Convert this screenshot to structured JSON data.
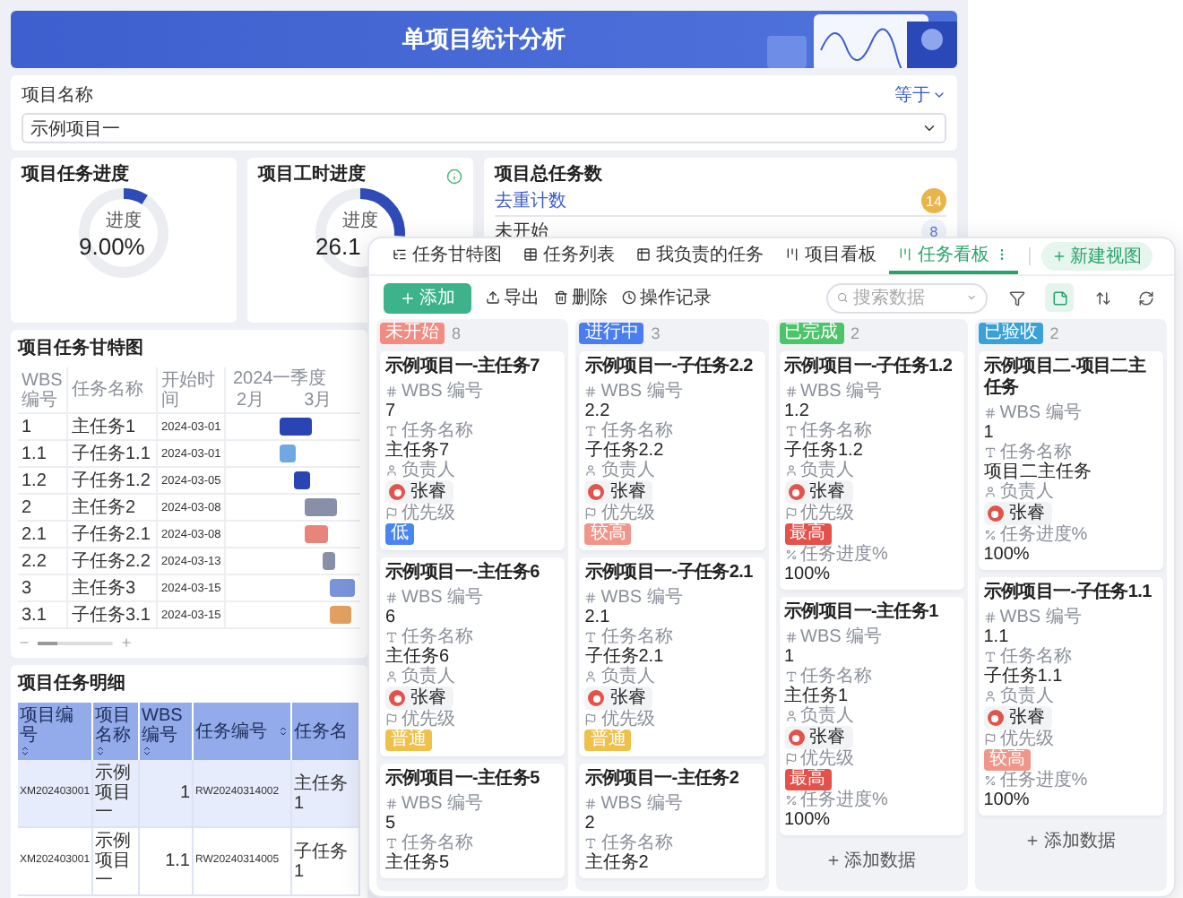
{
  "banner": {
    "title": "单项目统计分析"
  },
  "filter": {
    "label": "项目名称",
    "operator": "等于",
    "value": "示例项目一"
  },
  "progress_cards": [
    {
      "title": "项目任务进度",
      "caption": "进度",
      "value": "9.00%",
      "level": 0.09,
      "info": false
    },
    {
      "title": "项目工时进度",
      "caption": "进度",
      "value": "26.1",
      "level": 0.2617,
      "info": true
    }
  ],
  "total_tasks": {
    "title": "项目总任务数",
    "items": [
      {
        "label": "去重计数",
        "count": "14",
        "kind": "highlight"
      },
      {
        "label": "未开始",
        "count": "8",
        "kind": "plain"
      }
    ]
  },
  "gantt": {
    "title": "项目任务甘特图",
    "columns": [
      "WBS 编号",
      "任务名称",
      "开始时间"
    ],
    "period": "2024一季度",
    "months": [
      "2月",
      "3月"
    ],
    "rows": [
      {
        "wbs": "1",
        "name": "主任务1",
        "start": "2024-03-01",
        "color": "#2b44b3"
      },
      {
        "wbs": "1.1",
        "name": "子任务1.1",
        "start": "2024-03-01",
        "color": "#6fa8e2"
      },
      {
        "wbs": "1.2",
        "name": "子任务1.2",
        "start": "2024-03-05",
        "color": "#2b44b3"
      },
      {
        "wbs": "2",
        "name": "主任务2",
        "start": "2024-03-08",
        "color": "#8a8fa8"
      },
      {
        "wbs": "2.1",
        "name": "子任务2.1",
        "start": "2024-03-08",
        "color": "#e8857a"
      },
      {
        "wbs": "2.2",
        "name": "子任务2.2",
        "start": "2024-03-13",
        "color": "#8a8fa8"
      },
      {
        "wbs": "3",
        "name": "主任务3",
        "start": "2024-03-15",
        "color": "#7b93d8"
      },
      {
        "wbs": "3.1",
        "name": "子任务3.1",
        "start": "2024-03-15",
        "color": "#e2a060"
      }
    ],
    "zoom": {
      "level": 0.25
    }
  },
  "details": {
    "title": "项目任务明细",
    "columns": [
      "项目编号",
      "项目名称",
      "WBS 编号",
      "任务编号",
      "任务名"
    ],
    "rows": [
      [
        "XM202403001",
        "示例项目一",
        "1",
        "RW20240314002",
        "主任务1"
      ],
      [
        "XM202403001",
        "示例项目一",
        "1.1",
        "RW20240314005",
        "子任务1"
      ]
    ]
  },
  "kanban": {
    "tabs": [
      {
        "label": "任务甘特图",
        "selected": false
      },
      {
        "label": "任务列表",
        "selected": false
      },
      {
        "label": "我负责的任务",
        "selected": false
      },
      {
        "label": "项目看板",
        "selected": false
      },
      {
        "label": "任务看板",
        "selected": true
      }
    ],
    "new_view": "新建视图",
    "toolbar": {
      "add": "添加",
      "actions": [
        "导出",
        "删除",
        "操作记录"
      ],
      "search_placeholder": "搜索数据"
    },
    "columns": [
      {
        "status": "未开始",
        "count": "8",
        "color": "#f28b82",
        "cards": [
          {
            "title": "示例项目一-主任务7",
            "fields": [
              {
                "kind": "wbs",
                "label": "WBS 编号",
                "value": "7"
              },
              {
                "kind": "name",
                "label": "任务名称",
                "value": "主任务7"
              },
              {
                "kind": "person",
                "label": "负责人",
                "value": "张睿"
              },
              {
                "kind": "priority",
                "label": "优先级",
                "value": "低",
                "color": "#4a86f0"
              }
            ]
          },
          {
            "title": "示例项目一-主任务6",
            "fields": [
              {
                "kind": "wbs",
                "label": "WBS 编号",
                "value": "6"
              },
              {
                "kind": "name",
                "label": "任务名称",
                "value": "主任务6"
              },
              {
                "kind": "person",
                "label": "负责人",
                "value": "张睿"
              },
              {
                "kind": "priority",
                "label": "优先级",
                "value": "普通",
                "color": "#eec14a"
              }
            ]
          },
          {
            "title": "示例项目一-主任务5",
            "fields": [
              {
                "kind": "wbs",
                "label": "WBS 编号",
                "value": "5"
              },
              {
                "kind": "name",
                "label": "任务名称",
                "value": "主任务5"
              }
            ]
          }
        ]
      },
      {
        "status": "进行中",
        "count": "3",
        "color": "#4a7ef0",
        "cards": [
          {
            "title": "示例项目一-子任务2.2",
            "fields": [
              {
                "kind": "wbs",
                "label": "WBS 编号",
                "value": "2.2"
              },
              {
                "kind": "name",
                "label": "任务名称",
                "value": "子任务2.2"
              },
              {
                "kind": "person",
                "label": "负责人",
                "value": "张睿"
              },
              {
                "kind": "priority",
                "label": "优先级",
                "value": "较高",
                "color": "#f0958a"
              }
            ]
          },
          {
            "title": "示例项目一-子任务2.1",
            "fields": [
              {
                "kind": "wbs",
                "label": "WBS 编号",
                "value": "2.1"
              },
              {
                "kind": "name",
                "label": "任务名称",
                "value": "子任务2.1"
              },
              {
                "kind": "person",
                "label": "负责人",
                "value": "张睿"
              },
              {
                "kind": "priority",
                "label": "优先级",
                "value": "普通",
                "color": "#eec14a"
              }
            ]
          },
          {
            "title": "示例项目一-主任务2",
            "fields": [
              {
                "kind": "wbs",
                "label": "WBS 编号",
                "value": "2"
              },
              {
                "kind": "name",
                "label": "任务名称",
                "value": "主任务2"
              }
            ]
          }
        ]
      },
      {
        "status": "已完成",
        "count": "2",
        "color": "#4cc46a",
        "add_label": "添加数据",
        "cards": [
          {
            "title": "示例项目一-子任务1.2",
            "fields": [
              {
                "kind": "wbs",
                "label": "WBS 编号",
                "value": "1.2"
              },
              {
                "kind": "name",
                "label": "任务名称",
                "value": "子任务1.2"
              },
              {
                "kind": "person",
                "label": "负责人",
                "value": "张睿"
              },
              {
                "kind": "priority",
                "label": "优先级",
                "value": "最高",
                "color": "#e4514a"
              },
              {
                "kind": "progress",
                "label": "任务进度%",
                "value": "100%"
              }
            ]
          },
          {
            "title": "示例项目一-主任务1",
            "fields": [
              {
                "kind": "wbs",
                "label": "WBS 编号",
                "value": "1"
              },
              {
                "kind": "name",
                "label": "任务名称",
                "value": "主任务1"
              },
              {
                "kind": "person",
                "label": "负责人",
                "value": "张睿"
              },
              {
                "kind": "priority",
                "label": "优先级",
                "value": "最高",
                "color": "#e4514a"
              },
              {
                "kind": "progress",
                "label": "任务进度%",
                "value": "100%"
              }
            ]
          }
        ]
      },
      {
        "status": "已验收",
        "count": "2",
        "color": "#3aa0d8",
        "add_label": "添加数据",
        "cards": [
          {
            "title": "示例项目二-项目二主任务",
            "fields": [
              {
                "kind": "wbs",
                "label": "WBS 编号",
                "value": "1"
              },
              {
                "kind": "name",
                "label": "任务名称",
                "value": "项目二主任务"
              },
              {
                "kind": "person",
                "label": "负责人",
                "value": "张睿"
              },
              {
                "kind": "progress",
                "label": "任务进度%",
                "value": "100%"
              }
            ]
          },
          {
            "title": "示例项目一-子任务1.1",
            "fields": [
              {
                "kind": "wbs",
                "label": "WBS 编号",
                "value": "1.1"
              },
              {
                "kind": "name",
                "label": "任务名称",
                "value": "子任务1.1"
              },
              {
                "kind": "person",
                "label": "负责人",
                "value": "张睿"
              },
              {
                "kind": "priority",
                "label": "优先级",
                "value": "较高",
                "color": "#f0958a"
              },
              {
                "kind": "progress",
                "label": "任务进度%",
                "value": "100%"
              }
            ]
          }
        ]
      }
    ]
  }
}
